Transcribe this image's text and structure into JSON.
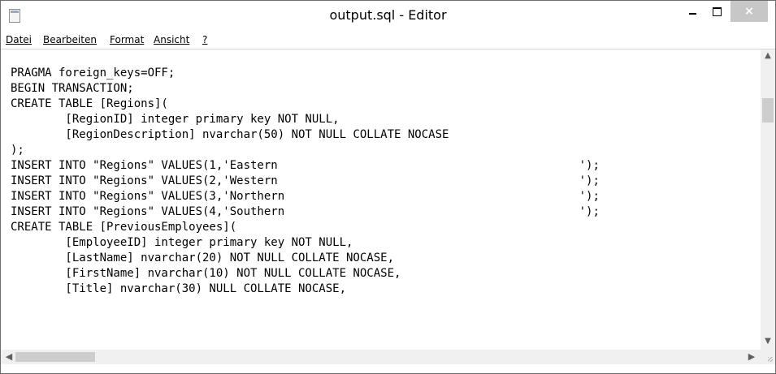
{
  "window": {
    "title": "output.sql - Editor",
    "close_glyph": "×"
  },
  "menu": {
    "items": [
      "Datei",
      "Bearbeiten",
      "Format",
      "Ansicht",
      "?"
    ]
  },
  "editor": {
    "lines": [
      "PRAGMA foreign_keys=OFF;",
      "BEGIN TRANSACTION;",
      "CREATE TABLE [Regions](",
      "        [RegionID] integer primary key NOT NULL,",
      "        [RegionDescription] nvarchar(50) NOT NULL COLLATE NOCASE",
      ");",
      "INSERT INTO \"Regions\" VALUES(1,'Eastern                                            ');",
      "INSERT INTO \"Regions\" VALUES(2,'Western                                            ');",
      "INSERT INTO \"Regions\" VALUES(3,'Northern                                           ');",
      "INSERT INTO \"Regions\" VALUES(4,'Southern                                           ');",
      "CREATE TABLE [PreviousEmployees](",
      "        [EmployeeID] integer primary key NOT NULL,",
      "        [LastName] nvarchar(20) NOT NULL COLLATE NOCASE,",
      "        [FirstName] nvarchar(10) NOT NULL COLLATE NOCASE,",
      "        [Title] nvarchar(30) NULL COLLATE NOCASE,"
    ]
  },
  "icons": {
    "app": "notepad-icon",
    "minimize": "minimize-icon",
    "maximize": "maximize-icon",
    "close": "close-icon",
    "scroll_up": "chevron-up-icon",
    "scroll_down": "chevron-down-icon",
    "scroll_left": "chevron-left-icon",
    "scroll_right": "chevron-right-icon"
  }
}
